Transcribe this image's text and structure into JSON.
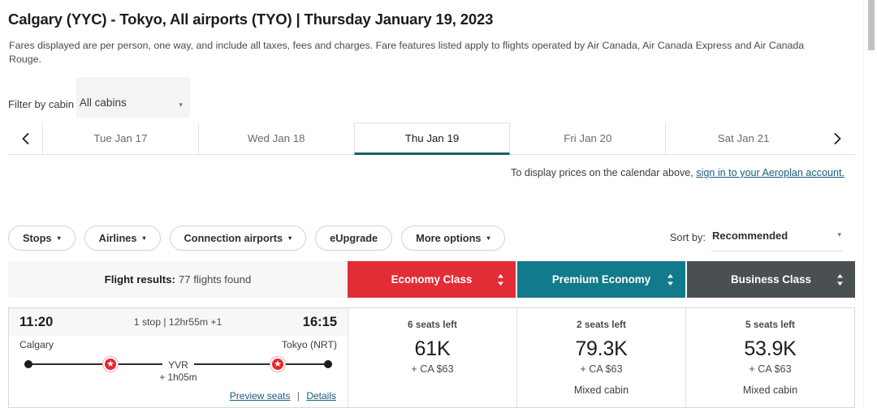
{
  "header": {
    "route": "Calgary (YYC) - Tokyo, All airports (TYO)",
    "separator": "|",
    "date": "Thursday January 19, 2023",
    "fare_note": "Fares displayed are per person, one way, and include all taxes, fees and charges. Fare features listed apply to flights operated by Air Canada, Air Canada Express and Air Canada Rouge."
  },
  "cabin_filter": {
    "label": "Filter by cabin",
    "value": "All cabins",
    "caret": "▾"
  },
  "date_tabs": {
    "prev_icon": "chevron-left-icon",
    "next_icon": "chevron-right-icon",
    "items": [
      {
        "label": "Tue Jan 17",
        "active": false
      },
      {
        "label": "Wed Jan 18",
        "active": false
      },
      {
        "label": "Thu Jan 19",
        "active": true
      },
      {
        "label": "Fri Jan 20",
        "active": false
      },
      {
        "label": "Sat Jan 21",
        "active": false
      }
    ]
  },
  "signin": {
    "text": "To display prices on the calendar above, ",
    "link": "sign in to your Aeroplan account."
  },
  "filters": [
    {
      "label": "Stops",
      "caret": "▾"
    },
    {
      "label": "Airlines",
      "caret": "▾"
    },
    {
      "label": "Connection airports",
      "caret": "▾"
    },
    {
      "label": "eUpgrade",
      "caret": ""
    },
    {
      "label": "More options",
      "caret": "▾"
    }
  ],
  "sort": {
    "label": "Sort by:",
    "value": "Recommended",
    "caret": "▾"
  },
  "results_bar": {
    "results_label": "Flight results:",
    "results_count": "77 flights found",
    "classes": [
      {
        "name": "Economy Class",
        "color": "#e32d36"
      },
      {
        "name": "Premium Economy",
        "color": "#117a8b"
      },
      {
        "name": "Business Class",
        "color": "#4a4f52"
      }
    ]
  },
  "flight": {
    "depart_time": "11:20",
    "arrive_time": "16:15",
    "stop_info": "1 stop | 12hr55m +1",
    "origin_city": "Calgary",
    "destination_city": "Tokyo (NRT)",
    "connection_code": "YVR",
    "layover": "+ 1h05m",
    "preview_seats": "Preview seats",
    "links_divider": "|",
    "details": "Details",
    "fares": [
      {
        "seats": "6 seats left",
        "points": "61K",
        "cash": "+ CA $63",
        "note": ""
      },
      {
        "seats": "2 seats left",
        "points": "79.3K",
        "cash": "+ CA $63",
        "note": "Mixed cabin"
      },
      {
        "seats": "5 seats left",
        "points": "53.9K",
        "cash": "+ CA $63",
        "note": "Mixed cabin"
      }
    ]
  }
}
